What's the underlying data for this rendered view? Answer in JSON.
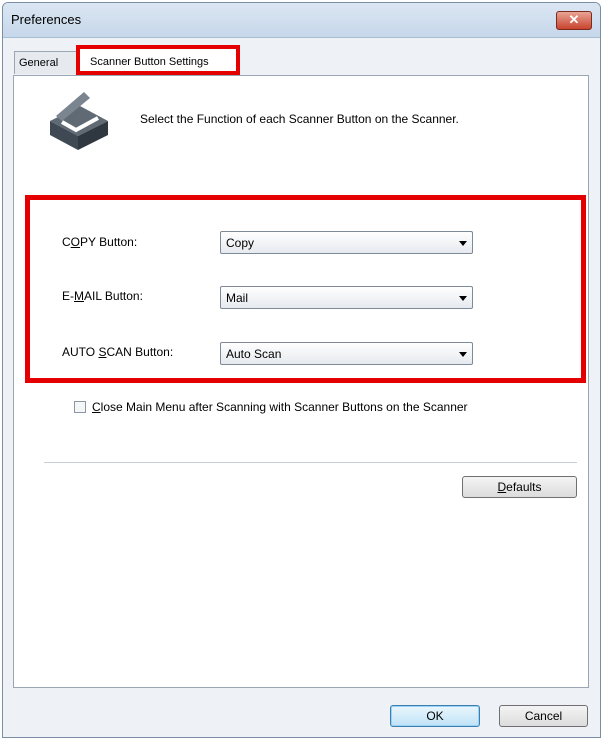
{
  "window": {
    "title": "Preferences",
    "close_glyph": "✕"
  },
  "tabs": [
    {
      "label": "General"
    },
    {
      "label": "Scanner Button Settings"
    }
  ],
  "description": "Select the Function of each Scanner Button on the Scanner.",
  "buttons_settings": [
    {
      "label_pre": "C",
      "label_mnemonic": "O",
      "label_post": "PY Button:",
      "value": "Copy"
    },
    {
      "label_pre": "E-",
      "label_mnemonic": "M",
      "label_post": "AIL Button:",
      "value": "Mail"
    },
    {
      "label_pre": "AUTO ",
      "label_mnemonic": "S",
      "label_post": "CAN Button:",
      "value": "Auto Scan"
    }
  ],
  "checkbox": {
    "mnemonic": "C",
    "label_rest": "lose Main Menu after Scanning with Scanner Buttons on the Scanner",
    "checked": false
  },
  "defaults_button": {
    "mnemonic": "D",
    "rest": "efaults"
  },
  "footer": {
    "ok": "OK",
    "cancel": "Cancel"
  },
  "icons": {
    "scanner": "scanner-icon",
    "close": "close-icon",
    "dropdown": "chevron-down-icon"
  },
  "colors": {
    "highlight": "#e40000",
    "close_button": "#c8442e"
  }
}
